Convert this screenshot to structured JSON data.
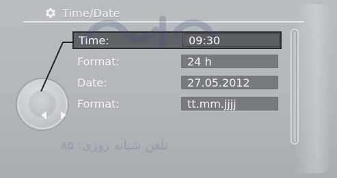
{
  "screen": {
    "title": "Time/Date",
    "icon": "gear-icon"
  },
  "settings": {
    "rows": [
      {
        "label": "Time:",
        "value": "09:30",
        "selected": true
      },
      {
        "label": "Format:",
        "value": "24 h",
        "selected": false
      },
      {
        "label": "Date:",
        "value": "27.05.2012",
        "selected": false
      },
      {
        "label": "Format:",
        "value": "tt.mm.jjjj",
        "selected": false
      }
    ]
  },
  "watermark": {
    "text": "تلفن شبانه روزی: ۸۵"
  },
  "colors": {
    "background": "#b3b7ba",
    "field": "#777b7f",
    "selected_border": "#2a2d30",
    "text": "#f7f8f9"
  }
}
